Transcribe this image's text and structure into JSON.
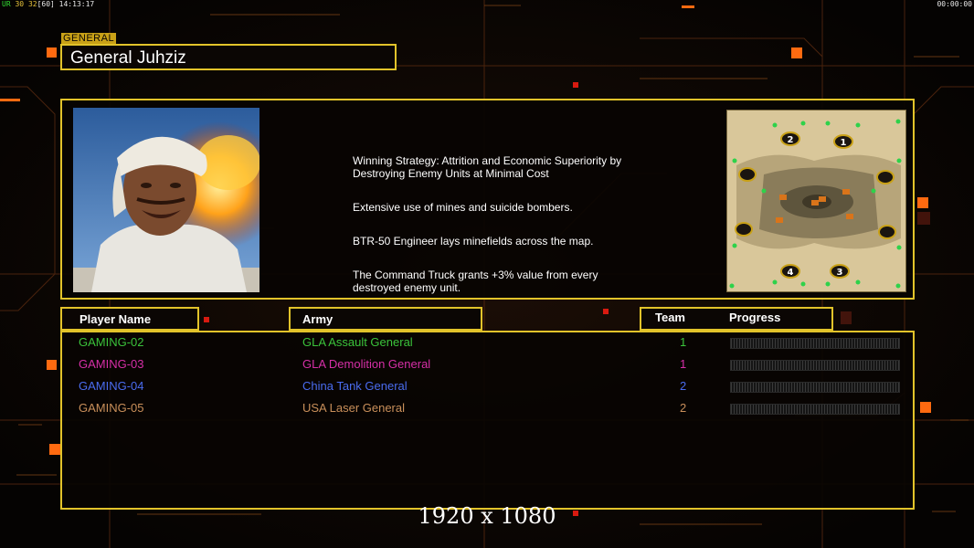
{
  "hud": {
    "left_prefix": "UR",
    "left_a": "30",
    "left_b": "32",
    "left_c": "[60]",
    "clock": "14:13:17",
    "timer": "00:00:00"
  },
  "general": {
    "section_label": "GENERAL",
    "name": "General Juhziz"
  },
  "strategy": [
    "Winning Strategy: Attrition and Economic Superiority by\n Destroying Enemy Units at Minimal Cost",
    "Extensive use of mines and suicide bombers.",
    "BTR-50 Engineer lays minefields across the map.",
    "The Command Truck grants +3% value from every\n destroyed enemy unit."
  ],
  "minimap": {
    "start_positions": [
      "1",
      "2",
      "3",
      "4"
    ]
  },
  "table": {
    "headers": {
      "player_name": "Player Name",
      "army": "Army",
      "team": "Team",
      "progress": "Progress"
    },
    "players": [
      {
        "name": "GAMING-02",
        "army": "GLA Assault General",
        "team": "1",
        "color": "#3bc43b",
        "progress": 0
      },
      {
        "name": "GAMING-03",
        "army": "GLA Demolition General",
        "team": "1",
        "color": "#d62fa7",
        "progress": 0
      },
      {
        "name": "GAMING-04",
        "army": "China Tank General",
        "team": "2",
        "color": "#4a6cf0",
        "progress": 0
      },
      {
        "name": "GAMING-05",
        "army": "USA Laser General",
        "team": "2",
        "color": "#c98f5a",
        "progress": 0
      }
    ]
  },
  "resolution_label": "1920 x 1080",
  "colors": {
    "frame": "#e2c32a",
    "accent_orange": "#ff6a10",
    "background": "#0b0604"
  }
}
